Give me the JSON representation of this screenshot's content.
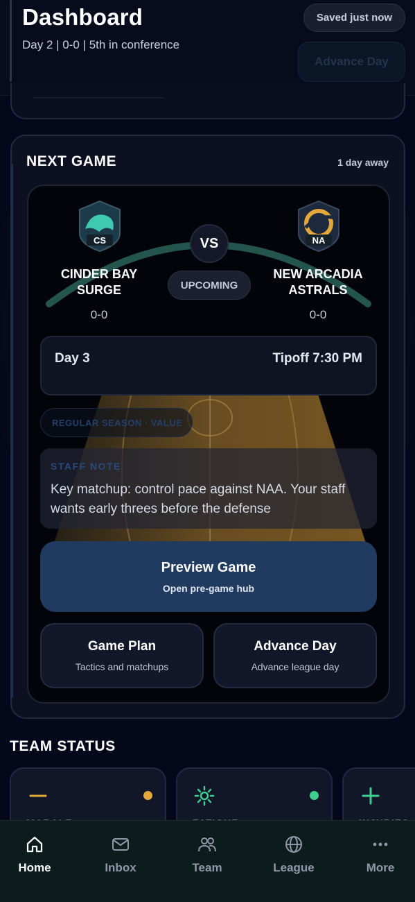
{
  "header": {
    "title": "Dashboard",
    "subtitle": "Day 2 | 0-0 | 5th in conference",
    "saved_status": "Saved just now",
    "advance_label": "Advance Day"
  },
  "next_game": {
    "heading": "NEXT GAME",
    "eta": "1 day away",
    "home": {
      "abbr": "CS",
      "name_line1": "CINDER BAY",
      "name_line2": "SURGE",
      "record": "0-0",
      "color": "#3fc9b0"
    },
    "away": {
      "abbr": "NA",
      "name_line1": "NEW ARCADIA",
      "name_line2": "ASTRALS",
      "record": "0-0",
      "color": "#e2a93a"
    },
    "vs_label": "VS",
    "status": "UPCOMING",
    "day": "Day 3",
    "tipoff": "Tipoff 7:30 PM",
    "game_type": "REGULAR SEASON · VALUE",
    "staff_note": {
      "label": "STAFF NOTE",
      "text": "Key matchup: control pace against NAA. Your staff wants early threes before the defense"
    },
    "preview": {
      "title": "Preview Game",
      "subtitle": "Open pre-game hub"
    },
    "game_plan": {
      "title": "Game Plan",
      "subtitle": "Tactics and matchups"
    },
    "advance_day": {
      "title": "Advance Day",
      "subtitle": "Advance league day"
    }
  },
  "team_status": {
    "title": "TEAM STATUS",
    "cards": [
      {
        "icon": "minus-icon",
        "caption": "MORALE",
        "dot_color": "#e2a93a",
        "icon_color": "#e2a93a"
      },
      {
        "icon": "sun-icon",
        "caption": "FATIGUE",
        "dot_color": "#3ecf8e",
        "icon_color": "#3ecf8e"
      },
      {
        "icon": "plus-icon",
        "caption": "INJURIES",
        "dot_color": "#3ecf8e",
        "icon_color": "#3ecf8e"
      }
    ]
  },
  "nav": {
    "items": [
      {
        "label": "Home",
        "icon": "home-icon",
        "active": true
      },
      {
        "label": "Inbox",
        "icon": "mail-icon",
        "active": false
      },
      {
        "label": "Team",
        "icon": "users-icon",
        "active": false
      },
      {
        "label": "League",
        "icon": "globe-icon",
        "active": false
      },
      {
        "label": "More",
        "icon": "more-icon",
        "active": false
      }
    ]
  }
}
